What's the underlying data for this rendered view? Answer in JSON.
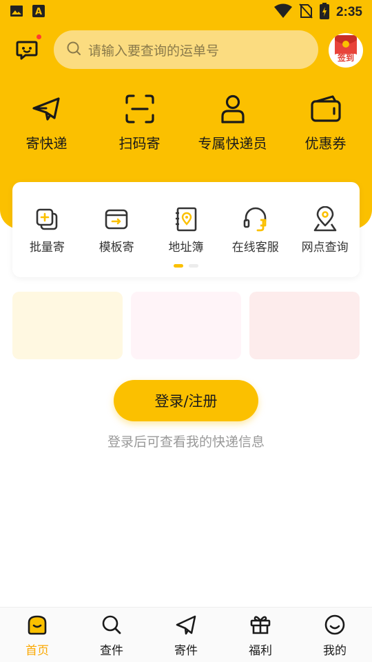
{
  "status_bar": {
    "time": "2:35",
    "icons": [
      "image-icon",
      "font-a-icon",
      "wifi-icon",
      "no-sim-icon",
      "battery-icon"
    ]
  },
  "header": {
    "search_placeholder": "请输入要查询的运单号",
    "checkin_label": "签到"
  },
  "main_actions": [
    {
      "label": "寄快递",
      "icon": "paper-plane-icon"
    },
    {
      "label": "扫码寄",
      "icon": "scan-icon"
    },
    {
      "label": "专属快递员",
      "icon": "courier-icon"
    },
    {
      "label": "优惠券",
      "icon": "coupon-wallet-icon"
    }
  ],
  "tools": [
    {
      "label": "批量寄",
      "icon": "batch-send-icon"
    },
    {
      "label": "模板寄",
      "icon": "template-icon"
    },
    {
      "label": "地址簿",
      "icon": "address-book-icon"
    },
    {
      "label": "在线客服",
      "icon": "headset-icon"
    },
    {
      "label": "网点查询",
      "icon": "location-pin-icon"
    }
  ],
  "promos": [
    {
      "color": "#FFF8E1"
    },
    {
      "color": "#FFF4F8"
    },
    {
      "color": "#FDECEC"
    }
  ],
  "login": {
    "button_label": "登录/注册",
    "hint": "登录后可查看我的快递信息"
  },
  "bottom_nav": [
    {
      "label": "首页",
      "icon": "home-icon",
      "active": true
    },
    {
      "label": "查件",
      "icon": "search-icon",
      "active": false
    },
    {
      "label": "寄件",
      "icon": "send-icon",
      "active": false
    },
    {
      "label": "福利",
      "icon": "gift-icon",
      "active": false
    },
    {
      "label": "我的",
      "icon": "smile-icon",
      "active": false
    }
  ],
  "colors": {
    "brand_yellow": "#FBC000",
    "search_bg": "#FBDC80",
    "active_nav": "#FBA800"
  }
}
